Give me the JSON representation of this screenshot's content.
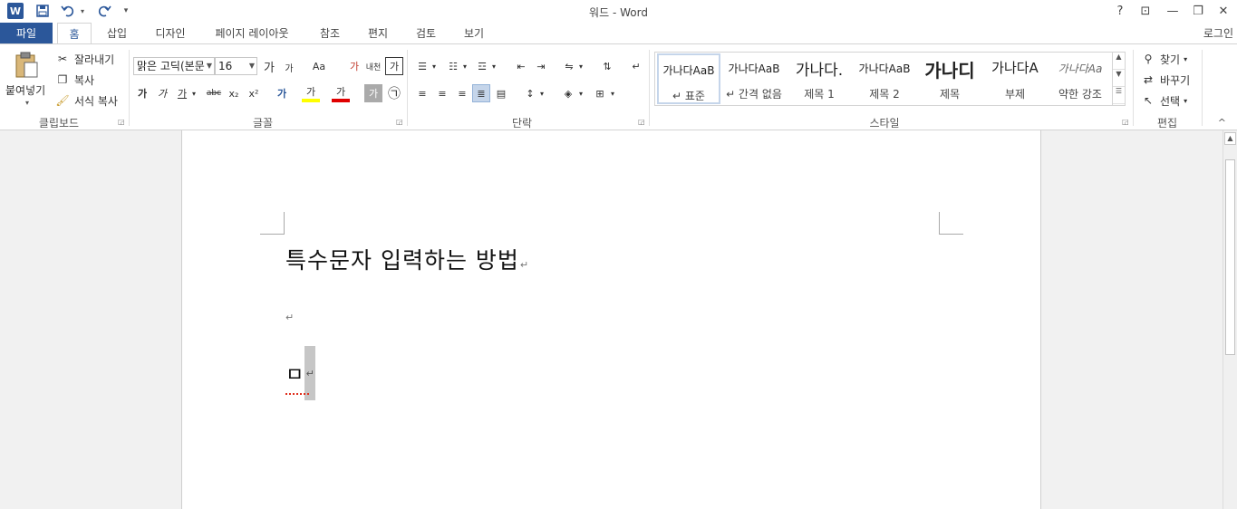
{
  "titlebar": {
    "title": "워드 - Word",
    "qat": {
      "app_icon": "W",
      "save_icon": "save-icon",
      "undo_icon": "undo-icon",
      "redo_icon": "redo-icon",
      "customize_icon": "customize-icon"
    },
    "help": "?",
    "ribbon_options": "⊡",
    "minimize": "—",
    "restore": "❐",
    "close": "✕"
  },
  "tabs": [
    {
      "label": "파일"
    },
    {
      "label": "홈"
    },
    {
      "label": "삽입"
    },
    {
      "label": "디자인"
    },
    {
      "label": "페이지 레이아웃"
    },
    {
      "label": "참조"
    },
    {
      "label": "편지"
    },
    {
      "label": "검토"
    },
    {
      "label": "보기"
    }
  ],
  "signin": "로그인",
  "clipboard": {
    "paste": "붙여넣기",
    "cut": "잘라내기",
    "copy": "복사",
    "format_painter": "서식 복사",
    "group_label": "클립보드"
  },
  "font": {
    "name": "맑은 고딕(본문",
    "size": "16",
    "grow": "가",
    "shrink": "가",
    "case": "Aa",
    "clear": "가",
    "phonetic": "내천",
    "border": "가",
    "bold": "가",
    "italic": "가",
    "underline": "가",
    "strike": "abc",
    "subscript": "x₂",
    "superscript": "x²",
    "effects": "가",
    "highlight": "가",
    "color": "가",
    "shading": "가",
    "enclose": "㉠",
    "group_label": "글꼴"
  },
  "paragraph": {
    "group_label": "단락"
  },
  "styles": {
    "items": [
      {
        "sample": "가나다AaB",
        "name": "↵ 표준"
      },
      {
        "sample": "가나다AaB",
        "name": "↵ 간격 없음"
      },
      {
        "sample": "가나다.",
        "name": "제목 1"
      },
      {
        "sample": "가나다AaB",
        "name": "제목 2"
      },
      {
        "sample": "가나디",
        "name": "제목"
      },
      {
        "sample": "가나다A",
        "name": "부제"
      },
      {
        "sample": "가나다Aa",
        "name": "약한 강조"
      }
    ],
    "group_label": "스타일"
  },
  "editing": {
    "find": "찾기",
    "replace": "바꾸기",
    "select": "선택",
    "group_label": "편집"
  },
  "document": {
    "heading": "특수문자 입력하는 방법",
    "paragraph_mark": "↵",
    "symbol_char": "ㅁ"
  }
}
